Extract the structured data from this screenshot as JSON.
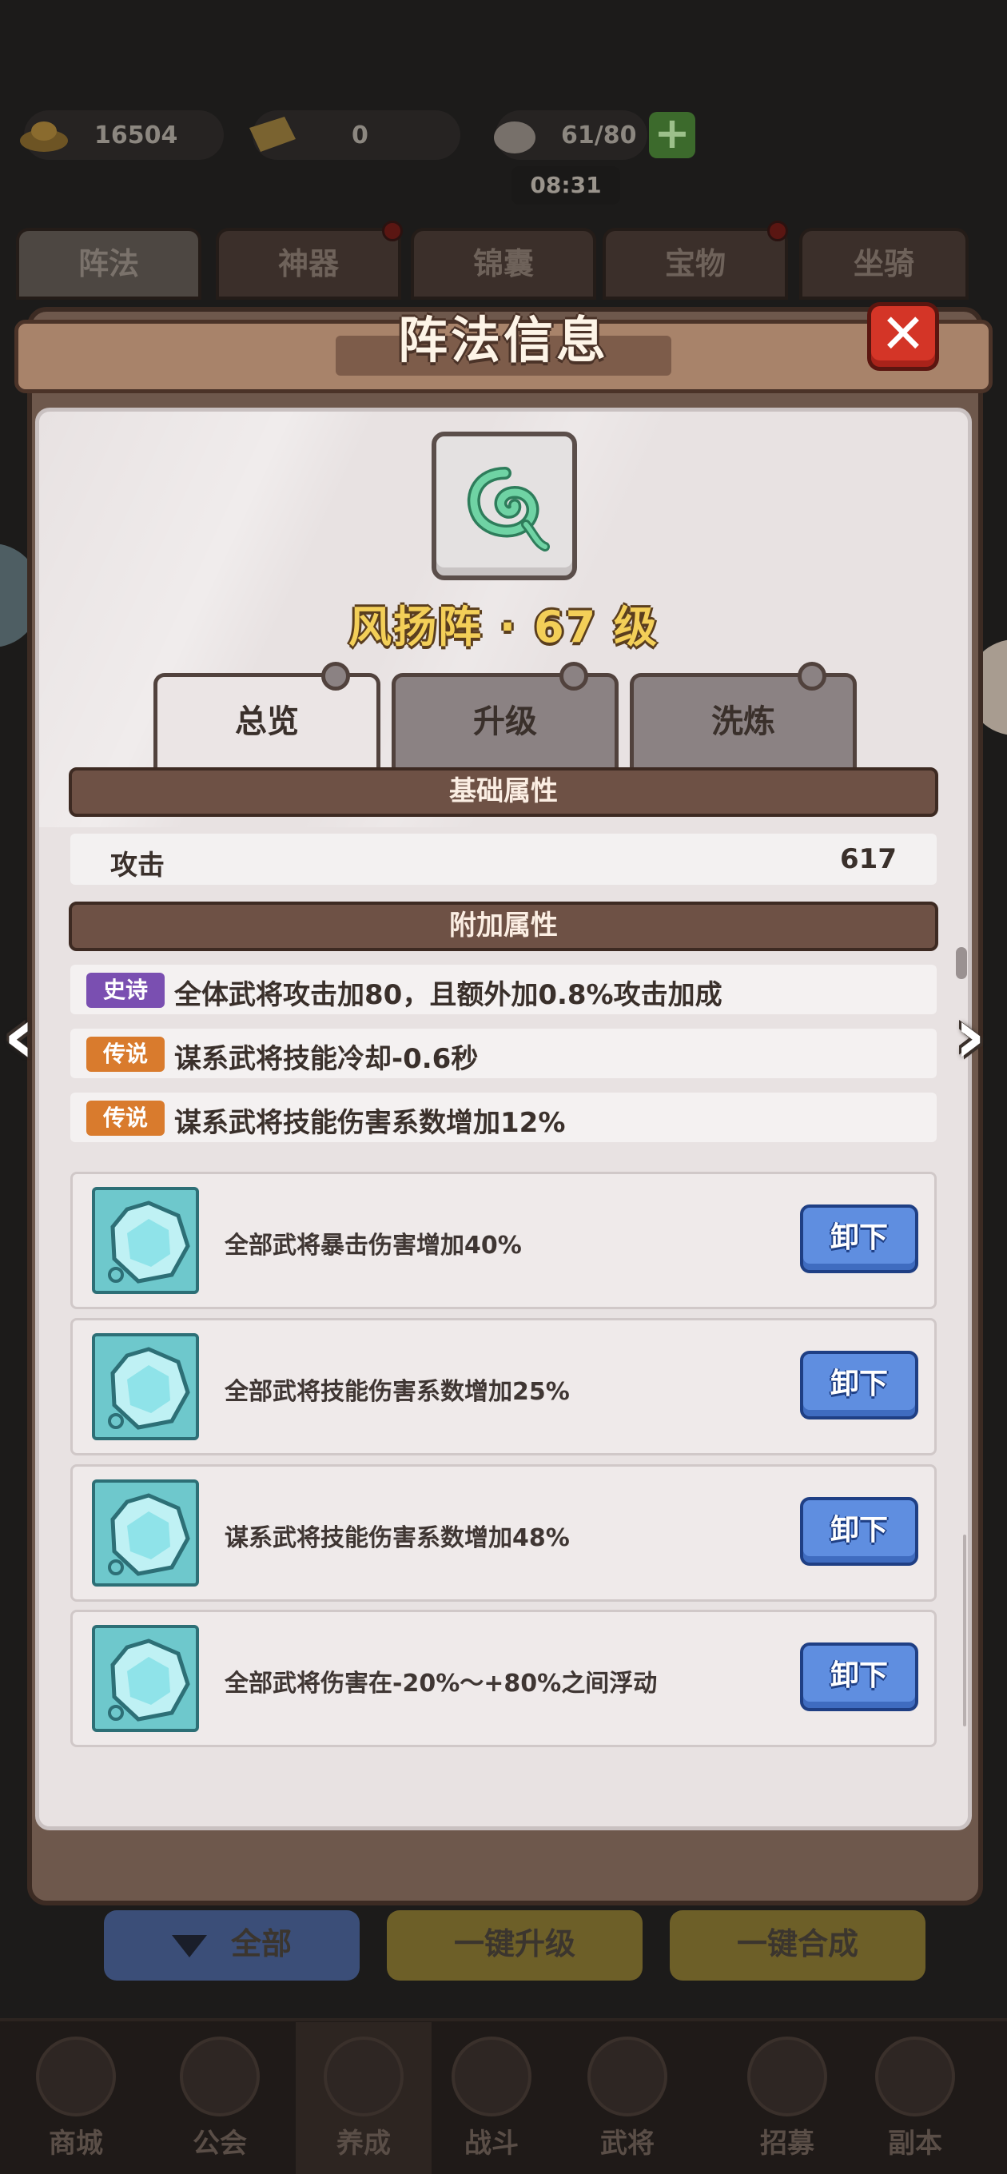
{
  "resources": {
    "gold": "16504",
    "ticket": "0",
    "stamina": "61/80",
    "timer": "08:31",
    "plus": "+"
  },
  "top_tabs": [
    "阵法",
    "神器",
    "锦囊",
    "宝物",
    "坐骑"
  ],
  "panel": {
    "title": "阵法信息",
    "close": "✕"
  },
  "item": {
    "name": "风扬阵 · 67 级",
    "icon": "green-swirl-icon"
  },
  "sub_tabs": [
    "总览",
    "升级",
    "洗炼"
  ],
  "base_section": {
    "title": "基础属性",
    "stats": [
      {
        "label": "攻击",
        "value": "617"
      }
    ]
  },
  "extra_section": {
    "title": "附加属性",
    "attrs": [
      {
        "badge": "史诗",
        "badge_color": "#7a4fb1",
        "text": "全体武将攻击加80，且额外加0.8%攻击加成"
      },
      {
        "badge": "传说",
        "badge_color": "#d97b2d",
        "text": "谋系武将技能冷却-0.6秒"
      },
      {
        "badge": "传说",
        "badge_color": "#d97b2d",
        "text": "谋系武将技能伤害系数增加12%"
      }
    ]
  },
  "gems": [
    {
      "text": "全部武将暴击伤害增加40%",
      "button": "卸下"
    },
    {
      "text": "全部武将技能伤害系数增加25%",
      "button": "卸下"
    },
    {
      "text": "谋系武将技能伤害系数增加48%",
      "button": "卸下"
    },
    {
      "text": "全部武将伤害在-20%～+80%之间浮动",
      "button": "卸下"
    }
  ],
  "arrows": {
    "left": "‹",
    "right": "›"
  },
  "bottom_actions": [
    "全部",
    "一键升级",
    "一键合成"
  ],
  "bottom_nav": [
    "商城",
    "公会",
    "养成",
    "战斗",
    "武将",
    "招募",
    "副本"
  ],
  "colors": {
    "panel_brown": "#6e584c",
    "title_gold": "#f3cf58",
    "unload_blue": "#5f8ee0",
    "close_red": "#d43527"
  }
}
